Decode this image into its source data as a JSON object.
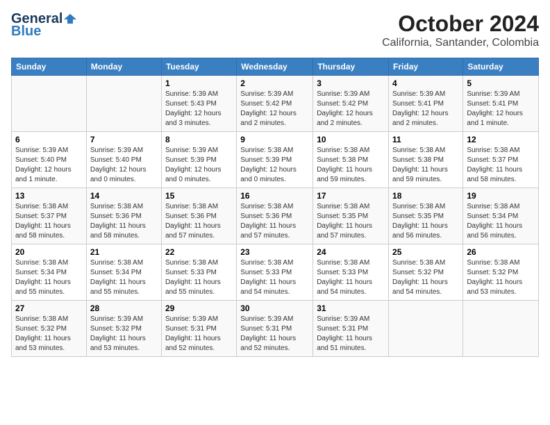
{
  "header": {
    "logo_general": "General",
    "logo_blue": "Blue",
    "title": "October 2024",
    "subtitle": "California, Santander, Colombia"
  },
  "days_of_week": [
    "Sunday",
    "Monday",
    "Tuesday",
    "Wednesday",
    "Thursday",
    "Friday",
    "Saturday"
  ],
  "weeks": [
    [
      {
        "day": "",
        "info": ""
      },
      {
        "day": "",
        "info": ""
      },
      {
        "day": "1",
        "info": "Sunrise: 5:39 AM\nSunset: 5:43 PM\nDaylight: 12 hours\nand 3 minutes."
      },
      {
        "day": "2",
        "info": "Sunrise: 5:39 AM\nSunset: 5:42 PM\nDaylight: 12 hours\nand 2 minutes."
      },
      {
        "day": "3",
        "info": "Sunrise: 5:39 AM\nSunset: 5:42 PM\nDaylight: 12 hours\nand 2 minutes."
      },
      {
        "day": "4",
        "info": "Sunrise: 5:39 AM\nSunset: 5:41 PM\nDaylight: 12 hours\nand 2 minutes."
      },
      {
        "day": "5",
        "info": "Sunrise: 5:39 AM\nSunset: 5:41 PM\nDaylight: 12 hours\nand 1 minute."
      }
    ],
    [
      {
        "day": "6",
        "info": "Sunrise: 5:39 AM\nSunset: 5:40 PM\nDaylight: 12 hours\nand 1 minute."
      },
      {
        "day": "7",
        "info": "Sunrise: 5:39 AM\nSunset: 5:40 PM\nDaylight: 12 hours\nand 0 minutes."
      },
      {
        "day": "8",
        "info": "Sunrise: 5:39 AM\nSunset: 5:39 PM\nDaylight: 12 hours\nand 0 minutes."
      },
      {
        "day": "9",
        "info": "Sunrise: 5:38 AM\nSunset: 5:39 PM\nDaylight: 12 hours\nand 0 minutes."
      },
      {
        "day": "10",
        "info": "Sunrise: 5:38 AM\nSunset: 5:38 PM\nDaylight: 11 hours\nand 59 minutes."
      },
      {
        "day": "11",
        "info": "Sunrise: 5:38 AM\nSunset: 5:38 PM\nDaylight: 11 hours\nand 59 minutes."
      },
      {
        "day": "12",
        "info": "Sunrise: 5:38 AM\nSunset: 5:37 PM\nDaylight: 11 hours\nand 58 minutes."
      }
    ],
    [
      {
        "day": "13",
        "info": "Sunrise: 5:38 AM\nSunset: 5:37 PM\nDaylight: 11 hours\nand 58 minutes."
      },
      {
        "day": "14",
        "info": "Sunrise: 5:38 AM\nSunset: 5:36 PM\nDaylight: 11 hours\nand 58 minutes."
      },
      {
        "day": "15",
        "info": "Sunrise: 5:38 AM\nSunset: 5:36 PM\nDaylight: 11 hours\nand 57 minutes."
      },
      {
        "day": "16",
        "info": "Sunrise: 5:38 AM\nSunset: 5:36 PM\nDaylight: 11 hours\nand 57 minutes."
      },
      {
        "day": "17",
        "info": "Sunrise: 5:38 AM\nSunset: 5:35 PM\nDaylight: 11 hours\nand 57 minutes."
      },
      {
        "day": "18",
        "info": "Sunrise: 5:38 AM\nSunset: 5:35 PM\nDaylight: 11 hours\nand 56 minutes."
      },
      {
        "day": "19",
        "info": "Sunrise: 5:38 AM\nSunset: 5:34 PM\nDaylight: 11 hours\nand 56 minutes."
      }
    ],
    [
      {
        "day": "20",
        "info": "Sunrise: 5:38 AM\nSunset: 5:34 PM\nDaylight: 11 hours\nand 55 minutes."
      },
      {
        "day": "21",
        "info": "Sunrise: 5:38 AM\nSunset: 5:34 PM\nDaylight: 11 hours\nand 55 minutes."
      },
      {
        "day": "22",
        "info": "Sunrise: 5:38 AM\nSunset: 5:33 PM\nDaylight: 11 hours\nand 55 minutes."
      },
      {
        "day": "23",
        "info": "Sunrise: 5:38 AM\nSunset: 5:33 PM\nDaylight: 11 hours\nand 54 minutes."
      },
      {
        "day": "24",
        "info": "Sunrise: 5:38 AM\nSunset: 5:33 PM\nDaylight: 11 hours\nand 54 minutes."
      },
      {
        "day": "25",
        "info": "Sunrise: 5:38 AM\nSunset: 5:32 PM\nDaylight: 11 hours\nand 54 minutes."
      },
      {
        "day": "26",
        "info": "Sunrise: 5:38 AM\nSunset: 5:32 PM\nDaylight: 11 hours\nand 53 minutes."
      }
    ],
    [
      {
        "day": "27",
        "info": "Sunrise: 5:38 AM\nSunset: 5:32 PM\nDaylight: 11 hours\nand 53 minutes."
      },
      {
        "day": "28",
        "info": "Sunrise: 5:39 AM\nSunset: 5:32 PM\nDaylight: 11 hours\nand 53 minutes."
      },
      {
        "day": "29",
        "info": "Sunrise: 5:39 AM\nSunset: 5:31 PM\nDaylight: 11 hours\nand 52 minutes."
      },
      {
        "day": "30",
        "info": "Sunrise: 5:39 AM\nSunset: 5:31 PM\nDaylight: 11 hours\nand 52 minutes."
      },
      {
        "day": "31",
        "info": "Sunrise: 5:39 AM\nSunset: 5:31 PM\nDaylight: 11 hours\nand 51 minutes."
      },
      {
        "day": "",
        "info": ""
      },
      {
        "day": "",
        "info": ""
      }
    ]
  ]
}
